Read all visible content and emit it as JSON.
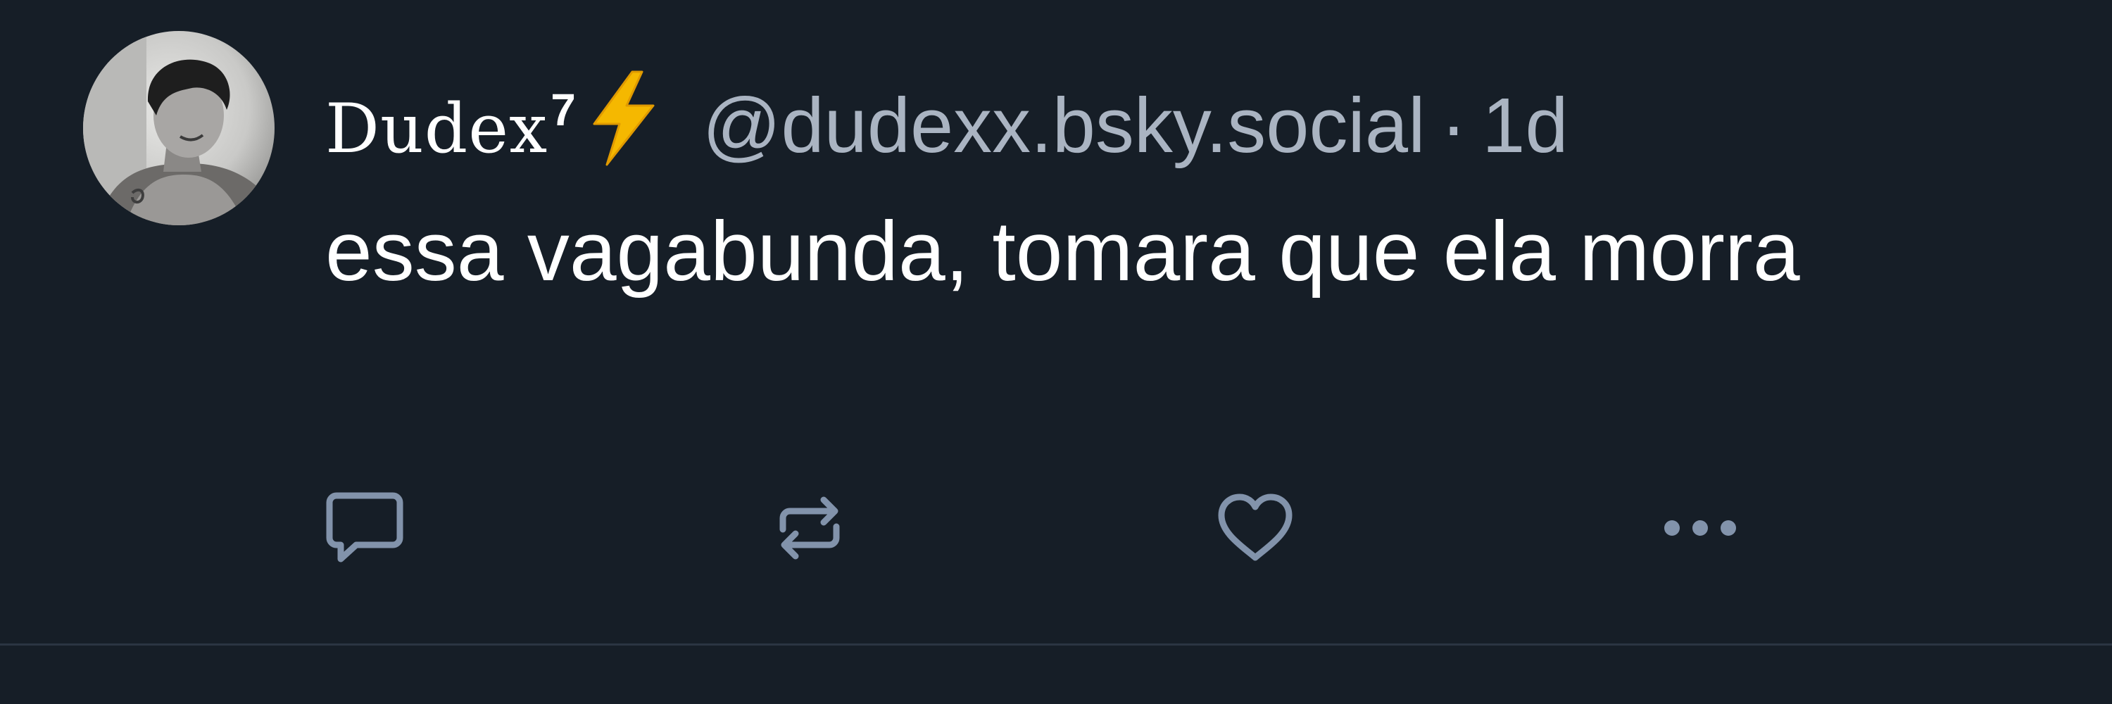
{
  "post": {
    "author_display_name": "Dudex",
    "author_name_superscript": "7",
    "author_emoji": "lightning-bolt",
    "handle": "@dudexx.bsky.social",
    "separator": "·",
    "timestamp": "1d",
    "text": "essa vagabunda, tomara que ela morra"
  },
  "actions": {
    "reply_icon": "speech-bubble-icon",
    "repost_icon": "repost-arrows-icon",
    "like_icon": "heart-icon",
    "more_icon": "ellipsis-icon"
  },
  "colors": {
    "background": "#161e27",
    "text_primary": "#ffffff",
    "text_secondary": "#aab4c2",
    "icon": "#8293ab",
    "divider": "#2b3542",
    "bolt": "#f5b800"
  }
}
